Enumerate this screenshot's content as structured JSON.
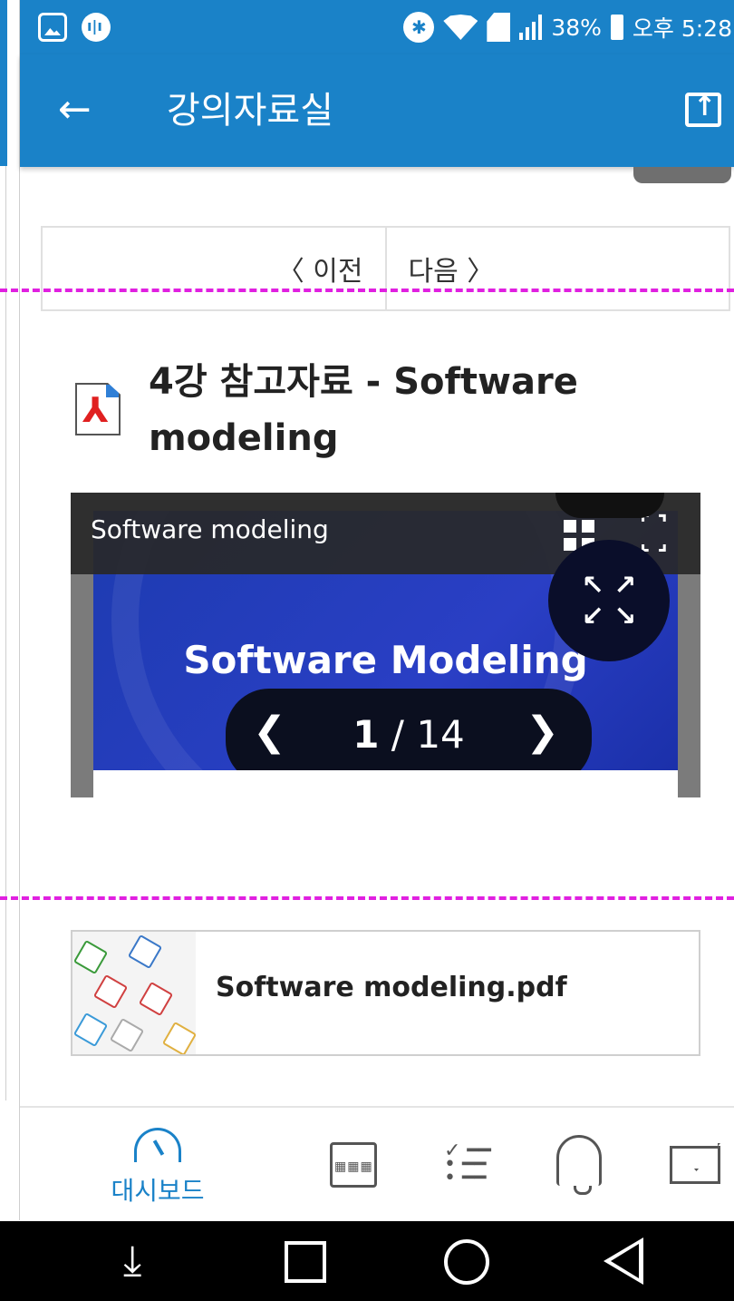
{
  "status_bar": {
    "battery_percent": "38%",
    "time": "오후 5:28",
    "left_icons": [
      "image-icon",
      "voice-recorder-icon"
    ],
    "right_icons": [
      "bluetooth-icon",
      "wifi-icon",
      "sim-icon",
      "signal-icon",
      "battery-icon"
    ]
  },
  "app_bar": {
    "title": "강의자료실",
    "back_icon": "arrow-left-icon",
    "action_icon": "upload-icon"
  },
  "pager": {
    "prev_label": "〈 이전",
    "next_label": "다음 〉"
  },
  "document": {
    "title": "4강 참고자료 - Software modeling",
    "icon": "pdf-icon"
  },
  "viewer": {
    "title": "Software modeling",
    "slide_heading": "Software Modeling",
    "current_page": "1",
    "page_separator": " / ",
    "total_pages": "14",
    "prev_icon": "chevron-left-icon",
    "next_icon": "chevron-right-icon"
  },
  "attachment": {
    "file_name": "Software modeling.pdf"
  },
  "bottom_nav": {
    "items": [
      {
        "label": "대시보드",
        "icon": "dashboard-icon",
        "active": true
      },
      {
        "label": "",
        "icon": "calendar-icon",
        "active": false
      },
      {
        "label": "",
        "icon": "checklist-icon",
        "active": false
      },
      {
        "label": "",
        "icon": "bell-icon",
        "active": false
      },
      {
        "label": "",
        "icon": "mail-icon",
        "active": false
      }
    ]
  },
  "system_nav": {
    "icons": [
      "download-icon",
      "recent-apps-icon",
      "home-icon",
      "back-icon"
    ]
  },
  "colors": {
    "primary": "#1a82c8",
    "dashed_guide": "#e020e0",
    "slide_blue": "#2a3fc5"
  }
}
